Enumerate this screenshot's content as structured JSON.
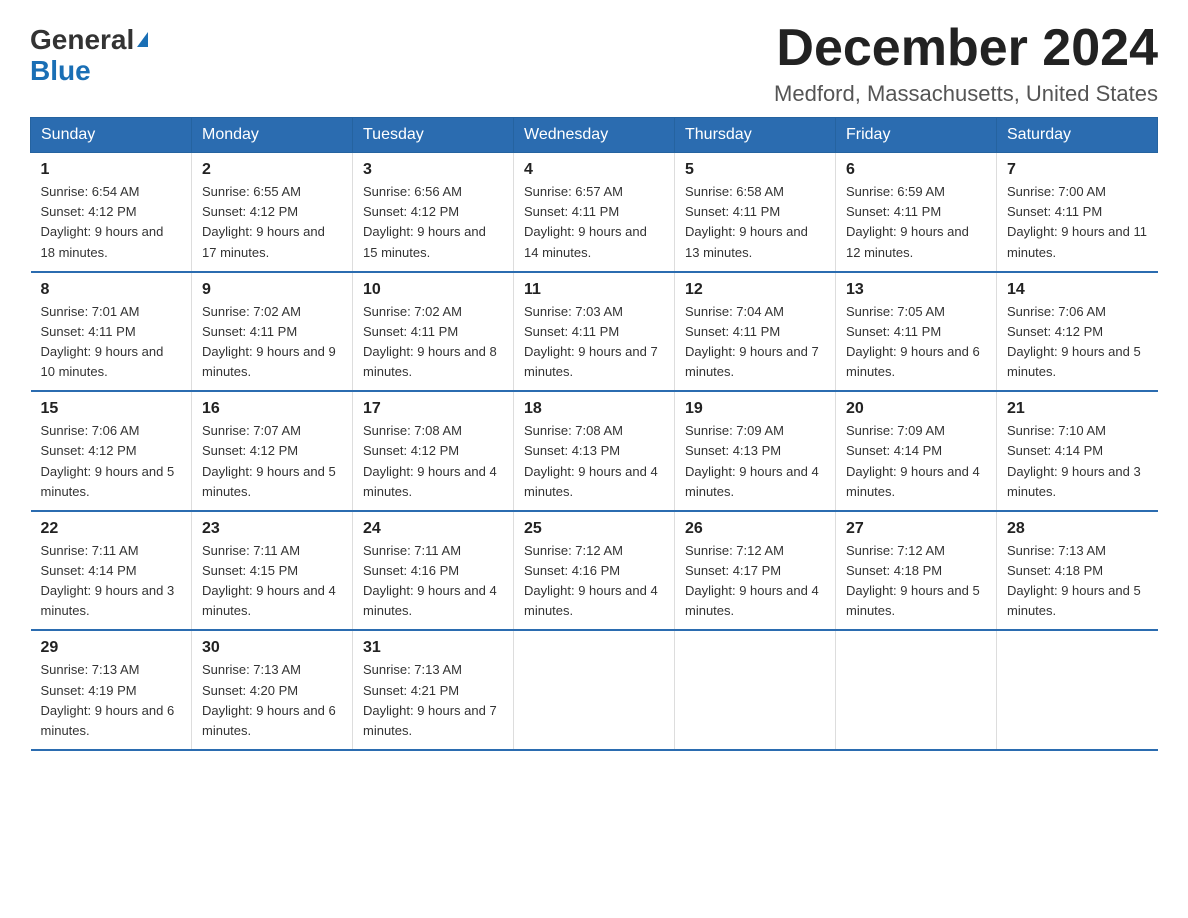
{
  "logo": {
    "general": "General",
    "blue": "Blue"
  },
  "title": "December 2024",
  "location": "Medford, Massachusetts, United States",
  "days_of_week": [
    "Sunday",
    "Monday",
    "Tuesday",
    "Wednesday",
    "Thursday",
    "Friday",
    "Saturday"
  ],
  "weeks": [
    [
      {
        "day": "1",
        "sunrise": "6:54 AM",
        "sunset": "4:12 PM",
        "daylight": "9 hours and 18 minutes."
      },
      {
        "day": "2",
        "sunrise": "6:55 AM",
        "sunset": "4:12 PM",
        "daylight": "9 hours and 17 minutes."
      },
      {
        "day": "3",
        "sunrise": "6:56 AM",
        "sunset": "4:12 PM",
        "daylight": "9 hours and 15 minutes."
      },
      {
        "day": "4",
        "sunrise": "6:57 AM",
        "sunset": "4:11 PM",
        "daylight": "9 hours and 14 minutes."
      },
      {
        "day": "5",
        "sunrise": "6:58 AM",
        "sunset": "4:11 PM",
        "daylight": "9 hours and 13 minutes."
      },
      {
        "day": "6",
        "sunrise": "6:59 AM",
        "sunset": "4:11 PM",
        "daylight": "9 hours and 12 minutes."
      },
      {
        "day": "7",
        "sunrise": "7:00 AM",
        "sunset": "4:11 PM",
        "daylight": "9 hours and 11 minutes."
      }
    ],
    [
      {
        "day": "8",
        "sunrise": "7:01 AM",
        "sunset": "4:11 PM",
        "daylight": "9 hours and 10 minutes."
      },
      {
        "day": "9",
        "sunrise": "7:02 AM",
        "sunset": "4:11 PM",
        "daylight": "9 hours and 9 minutes."
      },
      {
        "day": "10",
        "sunrise": "7:02 AM",
        "sunset": "4:11 PM",
        "daylight": "9 hours and 8 minutes."
      },
      {
        "day": "11",
        "sunrise": "7:03 AM",
        "sunset": "4:11 PM",
        "daylight": "9 hours and 7 minutes."
      },
      {
        "day": "12",
        "sunrise": "7:04 AM",
        "sunset": "4:11 PM",
        "daylight": "9 hours and 7 minutes."
      },
      {
        "day": "13",
        "sunrise": "7:05 AM",
        "sunset": "4:11 PM",
        "daylight": "9 hours and 6 minutes."
      },
      {
        "day": "14",
        "sunrise": "7:06 AM",
        "sunset": "4:12 PM",
        "daylight": "9 hours and 5 minutes."
      }
    ],
    [
      {
        "day": "15",
        "sunrise": "7:06 AM",
        "sunset": "4:12 PM",
        "daylight": "9 hours and 5 minutes."
      },
      {
        "day": "16",
        "sunrise": "7:07 AM",
        "sunset": "4:12 PM",
        "daylight": "9 hours and 5 minutes."
      },
      {
        "day": "17",
        "sunrise": "7:08 AM",
        "sunset": "4:12 PM",
        "daylight": "9 hours and 4 minutes."
      },
      {
        "day": "18",
        "sunrise": "7:08 AM",
        "sunset": "4:13 PM",
        "daylight": "9 hours and 4 minutes."
      },
      {
        "day": "19",
        "sunrise": "7:09 AM",
        "sunset": "4:13 PM",
        "daylight": "9 hours and 4 minutes."
      },
      {
        "day": "20",
        "sunrise": "7:09 AM",
        "sunset": "4:14 PM",
        "daylight": "9 hours and 4 minutes."
      },
      {
        "day": "21",
        "sunrise": "7:10 AM",
        "sunset": "4:14 PM",
        "daylight": "9 hours and 3 minutes."
      }
    ],
    [
      {
        "day": "22",
        "sunrise": "7:11 AM",
        "sunset": "4:14 PM",
        "daylight": "9 hours and 3 minutes."
      },
      {
        "day": "23",
        "sunrise": "7:11 AM",
        "sunset": "4:15 PM",
        "daylight": "9 hours and 4 minutes."
      },
      {
        "day": "24",
        "sunrise": "7:11 AM",
        "sunset": "4:16 PM",
        "daylight": "9 hours and 4 minutes."
      },
      {
        "day": "25",
        "sunrise": "7:12 AM",
        "sunset": "4:16 PM",
        "daylight": "9 hours and 4 minutes."
      },
      {
        "day": "26",
        "sunrise": "7:12 AM",
        "sunset": "4:17 PM",
        "daylight": "9 hours and 4 minutes."
      },
      {
        "day": "27",
        "sunrise": "7:12 AM",
        "sunset": "4:18 PM",
        "daylight": "9 hours and 5 minutes."
      },
      {
        "day": "28",
        "sunrise": "7:13 AM",
        "sunset": "4:18 PM",
        "daylight": "9 hours and 5 minutes."
      }
    ],
    [
      {
        "day": "29",
        "sunrise": "7:13 AM",
        "sunset": "4:19 PM",
        "daylight": "9 hours and 6 minutes."
      },
      {
        "day": "30",
        "sunrise": "7:13 AM",
        "sunset": "4:20 PM",
        "daylight": "9 hours and 6 minutes."
      },
      {
        "day": "31",
        "sunrise": "7:13 AM",
        "sunset": "4:21 PM",
        "daylight": "9 hours and 7 minutes."
      },
      null,
      null,
      null,
      null
    ]
  ],
  "labels": {
    "sunrise": "Sunrise: ",
    "sunset": "Sunset: ",
    "daylight": "Daylight: "
  }
}
